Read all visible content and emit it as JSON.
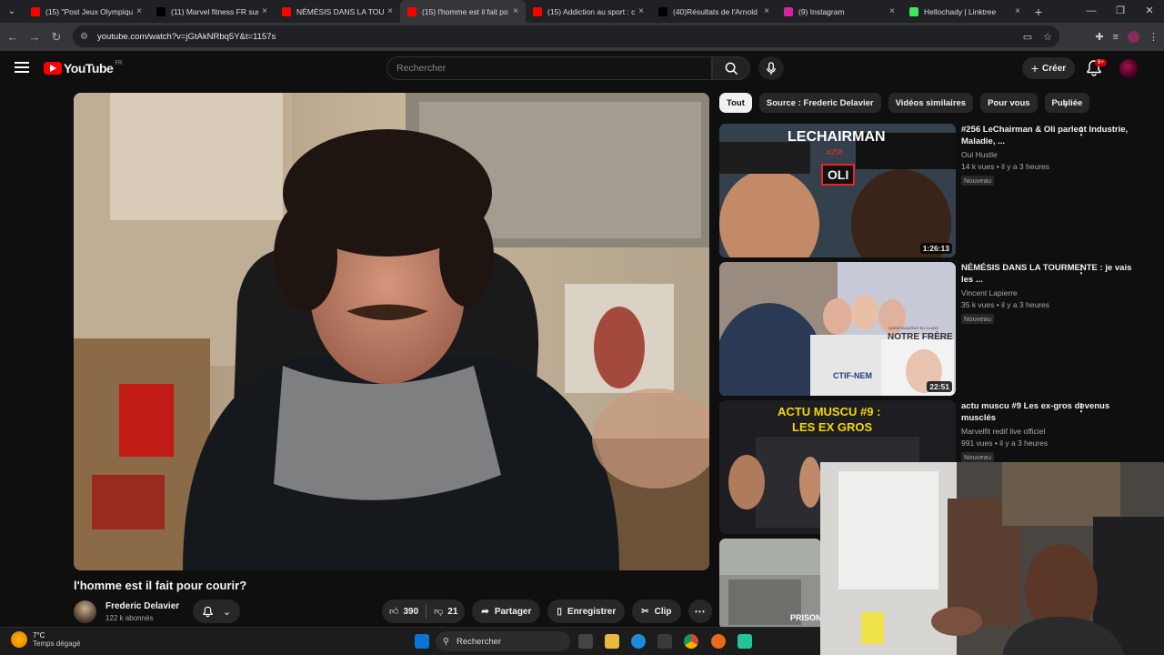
{
  "browser": {
    "tabs": [
      {
        "title": "(15) \"Post Jeux Olympiqu",
        "icon": "youtube-icon",
        "color": "#ff0000"
      },
      {
        "title": "(11) Marvel fitness FR sur",
        "icon": "x-icon",
        "color": "#000000"
      },
      {
        "title": "NÉMÉSIS DANS LA TOURI",
        "icon": "youtube-icon",
        "color": "#ff0000"
      },
      {
        "title": "(15) l'homme est il fait po",
        "icon": "youtube-icon",
        "color": "#ff0000"
      },
      {
        "title": "(15) Addiction au sport : c",
        "icon": "youtube-icon",
        "color": "#ff0000"
      },
      {
        "title": "(40)Résultats de l'Arnold",
        "icon": "tiktok-icon",
        "color": "#000000"
      },
      {
        "title": "(9) Instagram",
        "icon": "instagram-icon",
        "color": "#d6249f"
      },
      {
        "title": "Hellochady | Linktree",
        "icon": "linktree-icon",
        "color": "#43e660"
      }
    ],
    "active_tab": 3,
    "url": "youtube.com/watch?v=jGtAkNRbq5Y&t=1157s"
  },
  "youtube": {
    "logo_text": "YouTube",
    "country": "FR",
    "search_placeholder": "Rechercher",
    "create_label": "Créer",
    "notif_count": "9+"
  },
  "chips": [
    "Tout",
    "Source : Frederic Delavier",
    "Vidéos similaires",
    "Pour vous",
    "Publiée"
  ],
  "recommendations": [
    {
      "title": "#256 LeChairman & Oli parlent Industrie, Maladie, ...",
      "channel": "Oui Hustle",
      "meta": "14 k vues • il y a 3 heures",
      "badge": "Nouveau",
      "duration": "1:26:13",
      "thumb_title": "LECHAIRMAN",
      "thumb_tag": "OLI",
      "thumb_num": "#256"
    },
    {
      "title": "NÉMÉSIS DANS LA TOURMENTE : je vais les ...",
      "channel": "Vincent Lapierre",
      "meta": "35 k vues • il y a 3 heures",
      "badge": "Nouveau",
      "duration": "22:51",
      "thumb_title": "NOTRE FRÈRE",
      "thumb_tag": "CTIF-NEM",
      "thumb_sub": "QUENTIN AURAIT EU 24 ANS"
    },
    {
      "title": "actu muscu #9 Les ex-gros devenus musclés",
      "channel": "Marvelfit redif live officiel",
      "meta": "991 vues • il y a 3 heures",
      "badge": "Nouveau",
      "thumb_title": "ACTU MUSCU #9 :",
      "thumb_tag": "LES EX GROS"
    },
    {
      "thumb_tag": "PRISON"
    }
  ],
  "video": {
    "title": "l'homme est il fait pour courir?",
    "channel": "Frederic Delavier",
    "subscribers": "122 k abonnés",
    "likes": "390",
    "dislikes": "21",
    "share_label": "Partager",
    "save_label": "Enregistrer",
    "clip_label": "Clip"
  },
  "taskbar": {
    "temperature": "7°C",
    "weather": "Temps dégagé",
    "search_label": "Rechercher"
  }
}
